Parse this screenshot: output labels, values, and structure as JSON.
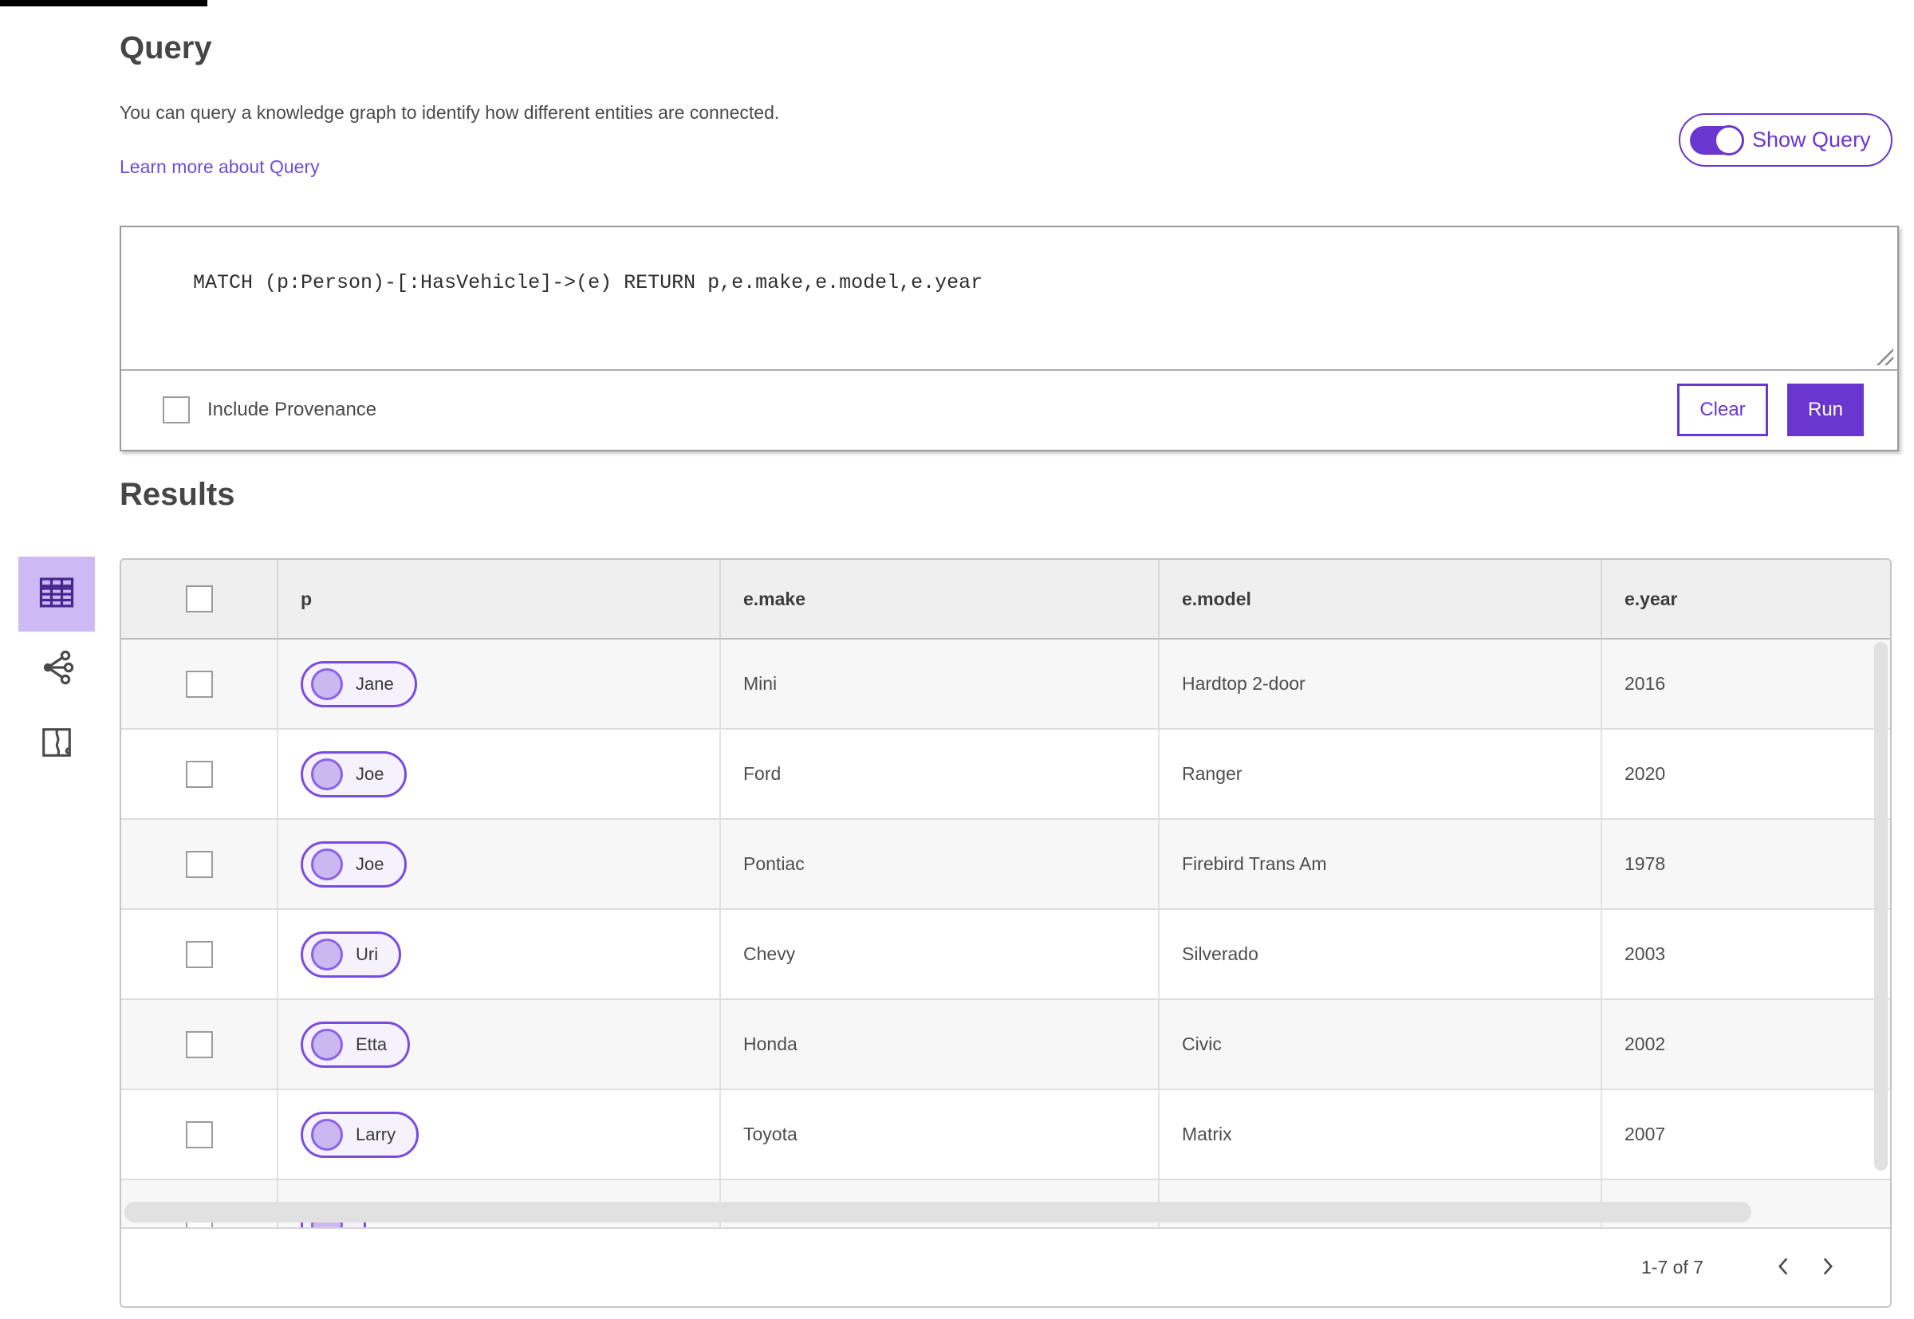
{
  "page": {
    "title": "Query",
    "description": "You can query a knowledge graph to identify how different entities are connected.",
    "learn_more_link": "Learn more about Query",
    "show_query_label": "Show Query",
    "show_query_on": true
  },
  "query_panel": {
    "query_text": "MATCH (p:Person)-[:HasVehicle]->(e) RETURN p,e.make,e.model,e.year",
    "include_provenance_label": "Include Provenance",
    "include_provenance_checked": false,
    "clear_label": "Clear",
    "run_label": "Run"
  },
  "results": {
    "heading": "Results",
    "view_icons": [
      {
        "name": "table-view-icon",
        "selected": true
      },
      {
        "name": "link-chart-view-icon",
        "selected": false
      },
      {
        "name": "map-view-icon",
        "selected": false
      }
    ],
    "table": {
      "columns": [
        "p",
        "e.make",
        "e.model",
        "e.year"
      ],
      "rows": [
        {
          "p": "Jane",
          "make": "Mini",
          "model": "Hardtop 2-door",
          "year": "2016"
        },
        {
          "p": "Joe",
          "make": "Ford",
          "model": "Ranger",
          "year": "2020"
        },
        {
          "p": "Joe",
          "make": "Pontiac",
          "model": "Firebird Trans Am",
          "year": "1978"
        },
        {
          "p": "Uri",
          "make": "Chevy",
          "model": "Silverado",
          "year": "2003"
        },
        {
          "p": "Etta",
          "make": "Honda",
          "model": "Civic",
          "year": "2002"
        },
        {
          "p": "Larry",
          "make": "Toyota",
          "model": "Matrix",
          "year": "2007"
        },
        {
          "p": "",
          "make": "",
          "model": "",
          "year": "",
          "partial": true
        }
      ]
    },
    "pagination": {
      "range_label": "1-7 of 7",
      "prev_icon": "chevron-left-icon",
      "next_icon": "chevron-right-icon"
    }
  },
  "colors": {
    "accent_purple": "#6a36d0",
    "link_purple": "#6b4fd8",
    "pill_border": "#7a4be0",
    "pill_fill": "#f5f2fd",
    "pill_circle_fill": "#cbb8f0",
    "selected_view_bg": "#cdb9f4",
    "table_header_bg": "#efefef",
    "row_alt_bg": "#f7f7f7"
  }
}
